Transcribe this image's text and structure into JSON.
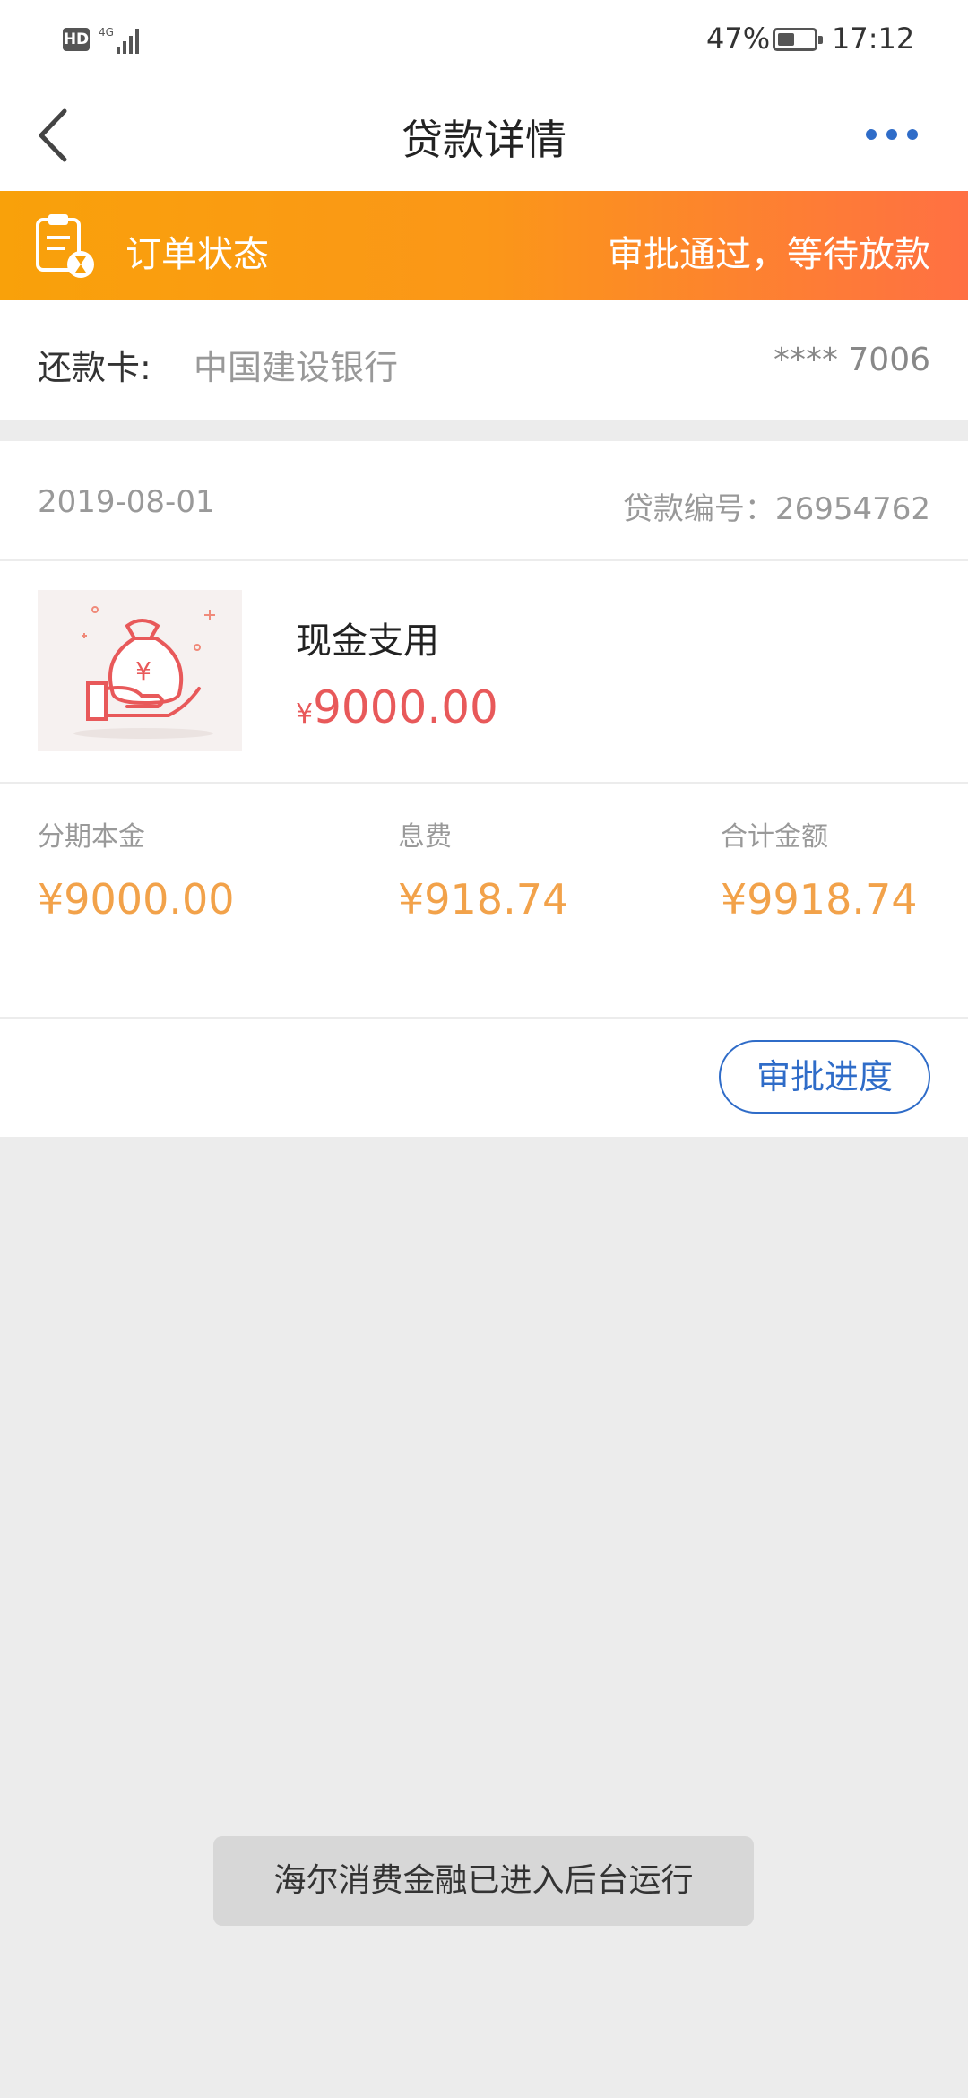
{
  "status_bar": {
    "hd_label": "HD",
    "network": "4G",
    "battery_percent": "47%",
    "battery_level": 0.47,
    "time": "17:12"
  },
  "nav": {
    "title": "贷款详情",
    "back_icon": "chevron-left-icon",
    "more_icon": "more-dots-icon"
  },
  "order_status": {
    "label": "订单状态",
    "value": "审批通过，等待放款",
    "icon": "clipboard-hourglass-icon"
  },
  "repayment_card": {
    "label": "还款卡:",
    "bank": "中国建设银行",
    "card_number": "**** 7006"
  },
  "loan": {
    "date": "2019-08-01",
    "loan_id": "贷款编号：26954762",
    "product_name": "现金支用",
    "currency_symbol": "¥",
    "amount": "9000.00",
    "summary": [
      {
        "label": "分期本金",
        "value": "¥9000.00"
      },
      {
        "label": "息费",
        "value": "¥918.74"
      },
      {
        "label": "合计金额",
        "value": "¥9918.74"
      }
    ],
    "approval_button": "审批进度"
  },
  "toast": "海尔消费金融已进入后台运行",
  "colors": {
    "accent_blue": "#2f6cc8",
    "banner_orange": "#f9a10a",
    "banner_red_orange": "#ff7043",
    "amount_red": "#e8595a",
    "summary_orange": "#f2a24a"
  }
}
